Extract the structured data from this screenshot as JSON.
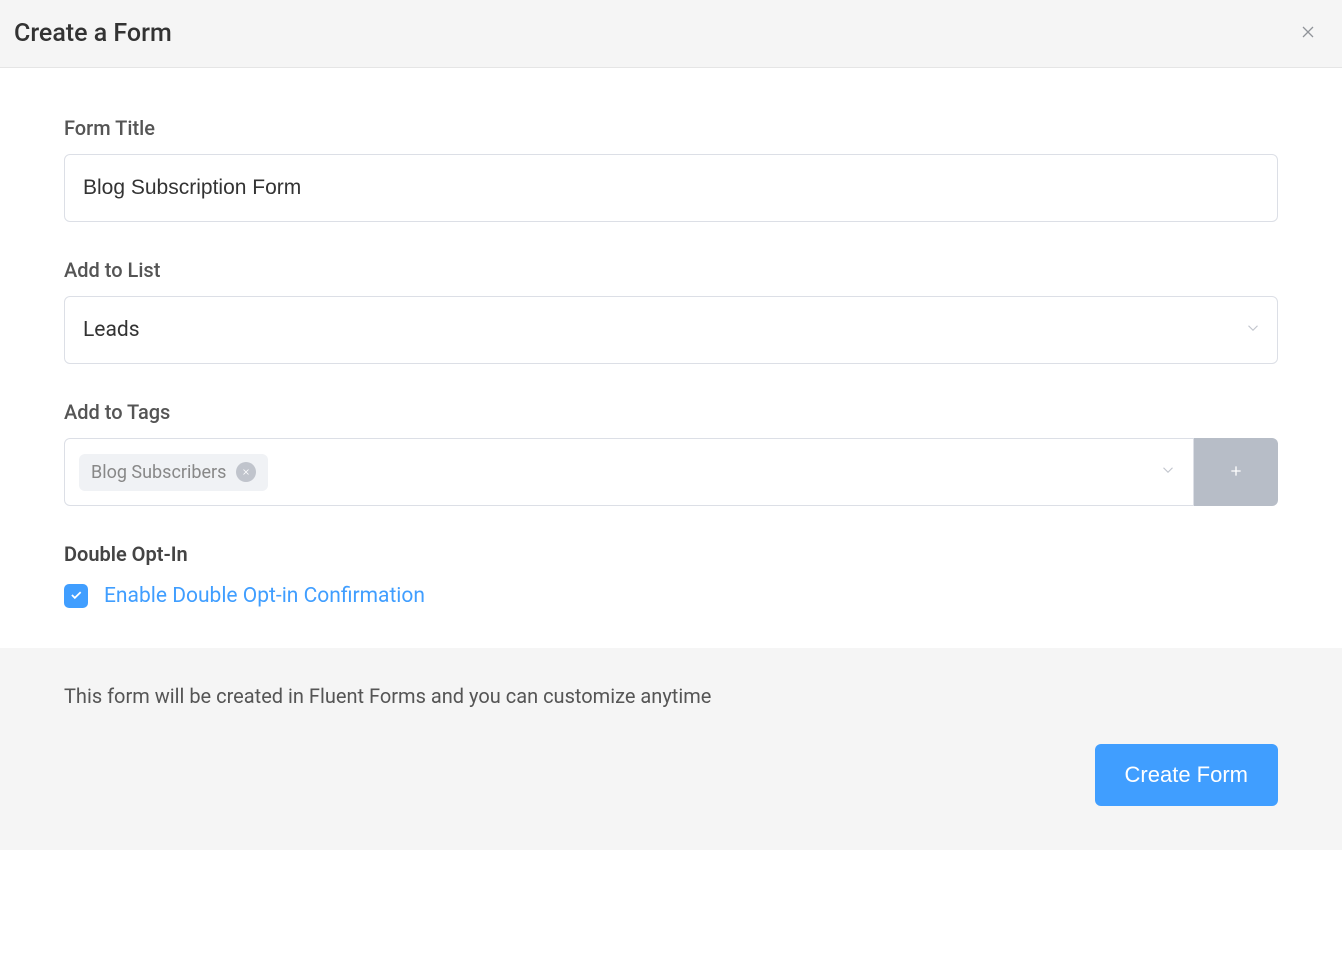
{
  "header": {
    "title": "Create a Form"
  },
  "form": {
    "title_label": "Form Title",
    "title_value": "Blog Subscription Form",
    "list_label": "Add to List",
    "list_value": "Leads",
    "tags_label": "Add to Tags",
    "tags": [
      {
        "label": "Blog Subscribers"
      }
    ],
    "optin_heading": "Double Opt-In",
    "optin_checkbox_label": "Enable Double Opt-in Confirmation",
    "optin_checked": true
  },
  "footer": {
    "note": "This form will be created in Fluent Forms and you can customize anytime",
    "submit_label": "Create Form"
  }
}
